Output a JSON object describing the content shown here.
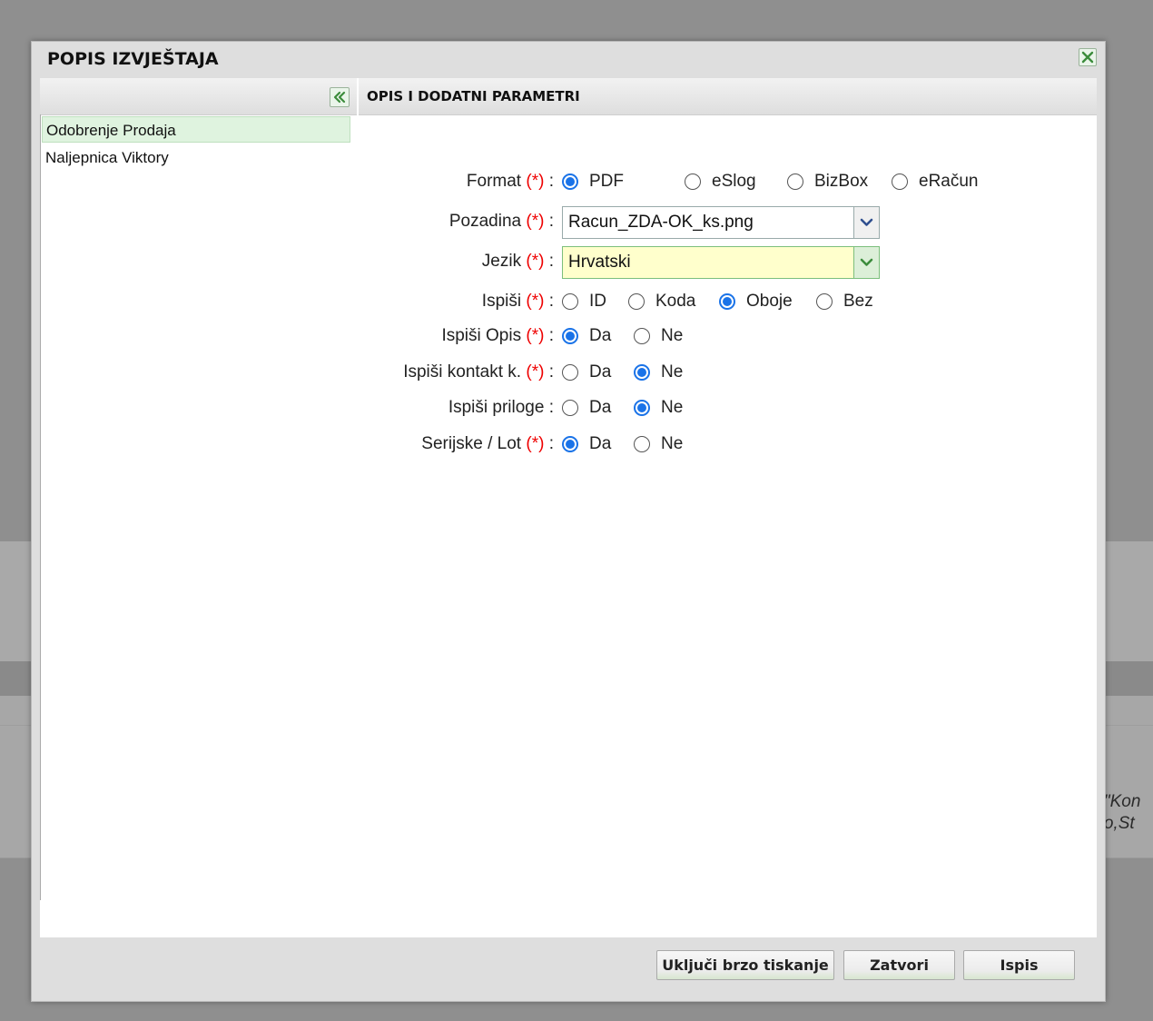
{
  "dialog": {
    "title": "POPIS IZVJEŠTAJA"
  },
  "sidebar": {
    "items": [
      {
        "label": "Odobrenje Prodaja",
        "selected": true
      },
      {
        "label": "Naljepnica Viktory",
        "selected": false
      }
    ]
  },
  "panel": {
    "header": "OPIS I DODATNI PARAMETRI"
  },
  "form": {
    "required_mark": "(*)",
    "format": {
      "label": "Format",
      "options": [
        "PDF",
        "eSlog",
        "BizBox",
        "eRačun"
      ],
      "selected": "PDF"
    },
    "pozadina": {
      "label": "Pozadina",
      "value": "Racun_ZDA-OK_ks.png"
    },
    "jezik": {
      "label": "Jezik",
      "value": "Hrvatski"
    },
    "ispisi": {
      "label": "Ispiši",
      "options": [
        "ID",
        "Koda",
        "Oboje",
        "Bez"
      ],
      "selected": "Oboje"
    },
    "ispisi_opis": {
      "label": "Ispiši Opis",
      "options": [
        "Da",
        "Ne"
      ],
      "selected": "Da"
    },
    "ispisi_kontakt": {
      "label": "Ispiši kontakt k.",
      "options": [
        "Da",
        "Ne"
      ],
      "selected": "Ne"
    },
    "ispisi_priloge": {
      "label": "Ispiši priloge",
      "options": [
        "Da",
        "Ne"
      ],
      "selected": "Ne"
    },
    "serijske": {
      "label": "Serijske / Lot",
      "options": [
        "Da",
        "Ne"
      ],
      "selected": "Da"
    }
  },
  "footer": {
    "quick_print_label": "Uključi brzo tiskanje",
    "close_label": "Zatvori",
    "print_label": "Ispis"
  },
  "background": {
    "text_line1": "e \"Kon",
    "text_line2": "nto,St"
  },
  "icons": {
    "close": "close-icon",
    "collapse": "double-chevron-left-icon",
    "dropdown": "chevron-down-icon"
  },
  "colors": {
    "accent_green": "#4a9a4a",
    "radio_blue": "#1a73e8",
    "required_red": "#e00000",
    "selected_row": "#dff3df"
  }
}
